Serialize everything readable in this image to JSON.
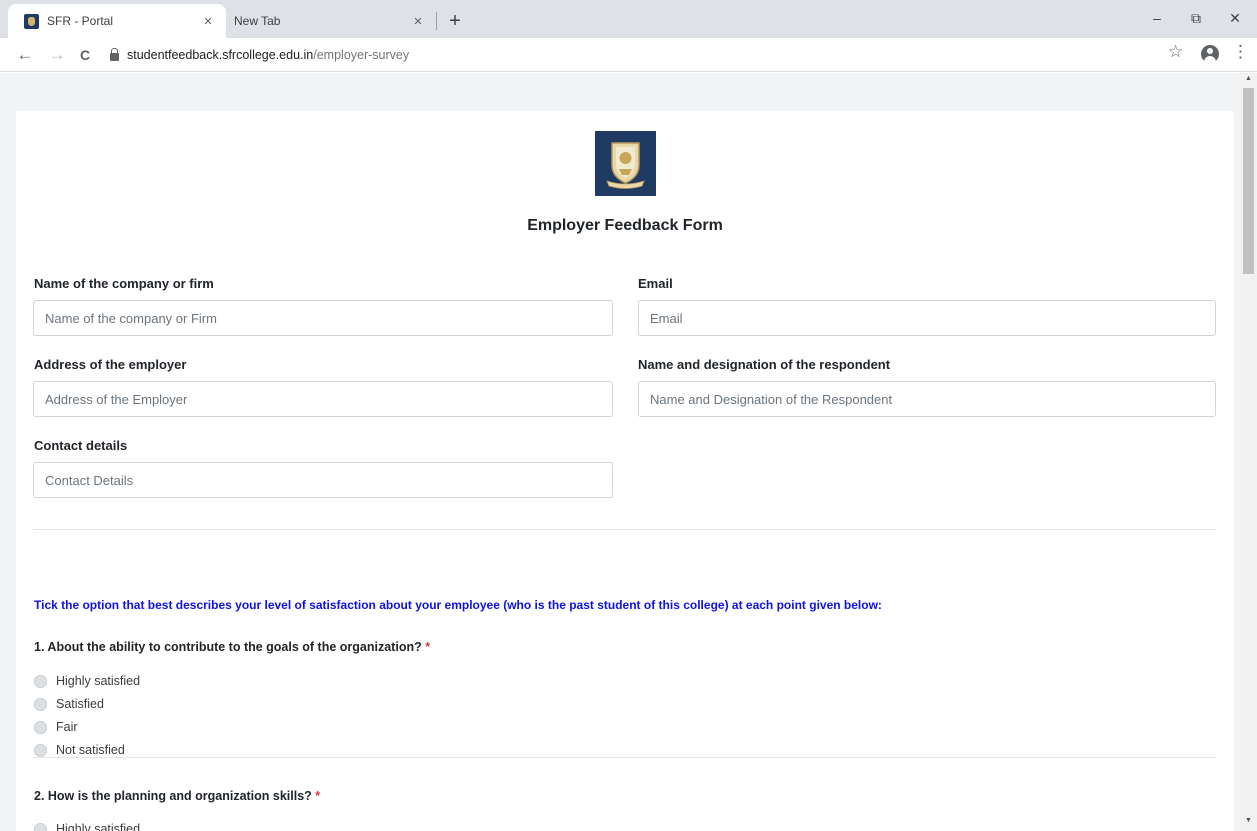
{
  "browser": {
    "tabs": [
      {
        "title": "SFR - Portal",
        "active": true
      },
      {
        "title": "New Tab",
        "active": false
      }
    ],
    "new_tab_symbol": "+",
    "close_symbol": "×",
    "window_controls": {
      "minimize": "–",
      "restore": "⧉",
      "close": "✕"
    },
    "nav": {
      "back": "←",
      "forward": "→",
      "reload": "C"
    },
    "address": {
      "host": "studentfeedback.sfrcollege.edu.in",
      "path": "/employer-survey"
    },
    "bookmark_symbol": "☆",
    "menu_symbol": "⋮",
    "icons": [
      "favicon-icon",
      "lock-icon",
      "star-icon",
      "profile-icon",
      "kebab-menu-icon"
    ]
  },
  "form": {
    "title": "Employer Feedback Form",
    "fields": {
      "company": {
        "label": "Name of the company or firm",
        "placeholder": "Name of the company or Firm"
      },
      "email": {
        "label": "Email",
        "placeholder": "Email"
      },
      "address": {
        "label": "Address of the employer",
        "placeholder": "Address of the Employer"
      },
      "respondent": {
        "label": "Name and designation of the respondent",
        "placeholder": "Name and Designation of the Respondent"
      },
      "contact": {
        "label": "Contact details",
        "placeholder": "Contact Details"
      }
    },
    "instruction": "Tick the option that best describes your level of satisfaction about your employee (who is the past student of this college) at each point given below:",
    "required_mark": "*",
    "questions": [
      {
        "text": "1. About the ability to contribute to the goals of the organization?",
        "options": [
          "Highly satisfied",
          "Satisfied",
          "Fair",
          "Not satisfied"
        ]
      },
      {
        "text": "2. How is the planning and organization skills?",
        "options": [
          "Highly satisfied"
        ]
      }
    ]
  },
  "colors": {
    "accent_instruction": "#1010e8",
    "required": "#dc3545",
    "logo_bg": "#1f3a63"
  }
}
